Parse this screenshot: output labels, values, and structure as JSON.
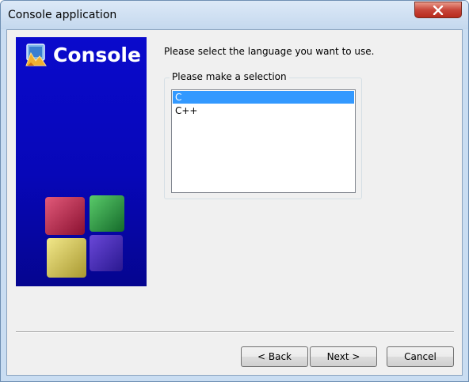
{
  "window": {
    "title": "Console application"
  },
  "banner": {
    "title": "Console"
  },
  "main": {
    "prompt": "Please select the language you want to use.",
    "group_label": "Please make a selection",
    "languages": [
      {
        "label": "C",
        "selected": true
      },
      {
        "label": "C++",
        "selected": false
      }
    ]
  },
  "buttons": {
    "back": "< Back",
    "next": "Next >",
    "cancel": "Cancel"
  },
  "icons": {
    "close": "close-icon",
    "banner": "console-app-icon",
    "cubes": "codeblocks-cubes-logo"
  }
}
